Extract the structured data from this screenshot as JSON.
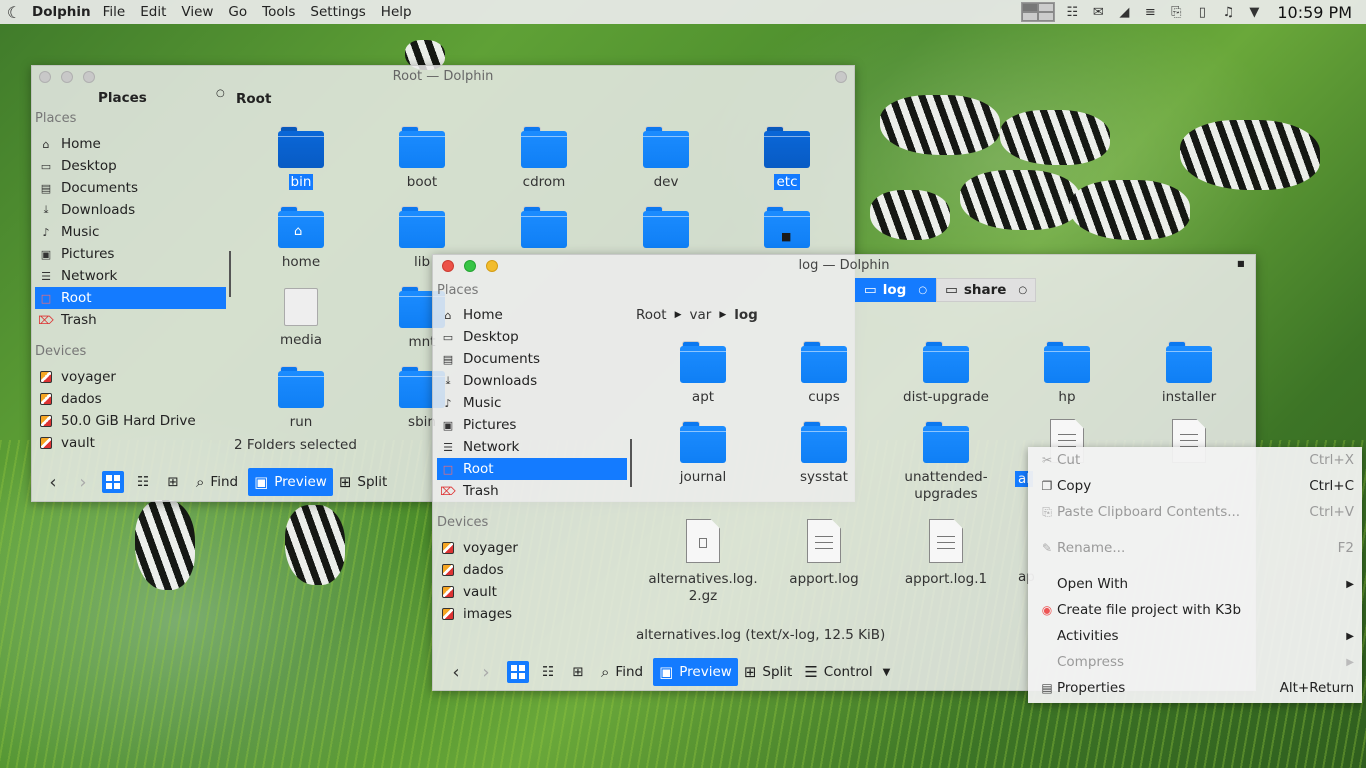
{
  "topbar": {
    "app_name": "Dolphin",
    "menus": [
      "File",
      "Edit",
      "View",
      "Go",
      "Tools",
      "Settings",
      "Help"
    ],
    "menu_underline": [
      "F",
      "E",
      "V",
      "G",
      "T",
      "S",
      "H"
    ],
    "clock": "10:59 PM"
  },
  "win1": {
    "title": "Root — Dolphin",
    "places_header": "Places",
    "location": "Root",
    "places_label": "Places",
    "places": [
      "Home",
      "Desktop",
      "Documents",
      "Downloads",
      "Music",
      "Pictures",
      "Network",
      "Root",
      "Trash"
    ],
    "devices_label": "Devices",
    "devices": [
      "voyager",
      "dados",
      "50.0 GiB Hard Drive",
      "vault"
    ],
    "folders": [
      "bin",
      "boot",
      "cdrom",
      "dev",
      "etc",
      "home",
      "lib",
      "",
      "",
      "",
      "media",
      "mnt",
      "run",
      "sbin"
    ],
    "status": "2 Folders selected",
    "toolbar": {
      "find": "Find",
      "preview": "Preview",
      "split": "Split"
    }
  },
  "win2": {
    "title": "log — Dolphin",
    "tabs": [
      {
        "label": "log"
      },
      {
        "label": "share"
      }
    ],
    "places_label": "Places",
    "places": [
      "Home",
      "Desktop",
      "Documents",
      "Downloads",
      "Music",
      "Pictures",
      "Network",
      "Root",
      "Trash"
    ],
    "devices_label": "Devices",
    "devices": [
      "voyager",
      "dados",
      "vault",
      "images"
    ],
    "breadcrumb": [
      "Root",
      "var",
      "log"
    ],
    "folders": [
      "apt",
      "cups",
      "dist-upgrade",
      "hp",
      "installer",
      "journal",
      "sysstat",
      "unattended-\nupgrades"
    ],
    "selected_partial": "al",
    "files": [
      "alternatives.log.\n2.gz",
      "apport.log",
      "apport.log.1",
      "ap"
    ],
    "status": "alternatives.log (text/x-log, 12.5 KiB)",
    "toolbar": {
      "find": "Find",
      "preview": "Preview",
      "split": "Split",
      "control": "Control"
    }
  },
  "context_menu": {
    "items": [
      {
        "label": "Cut",
        "shortcut": "Ctrl+X",
        "enabled": false,
        "icon": "scissors-icon"
      },
      {
        "label": "Copy",
        "shortcut": "Ctrl+C",
        "enabled": true,
        "icon": "copy-icon"
      },
      {
        "label": "Paste Clipboard Contents...",
        "shortcut": "Ctrl+V",
        "enabled": false,
        "icon": "paste-icon"
      },
      {
        "label": "Rename...",
        "shortcut": "F2",
        "enabled": false,
        "icon": "rename-icon"
      },
      {
        "label": "Open With",
        "shortcut": "",
        "enabled": true,
        "submenu": true
      },
      {
        "label": "Create file project with K3b",
        "shortcut": "",
        "enabled": true,
        "icon": "k3b-icon"
      },
      {
        "label": "Activities",
        "shortcut": "",
        "enabled": true,
        "submenu": true
      },
      {
        "label": "Compress",
        "shortcut": "",
        "enabled": false,
        "submenu": true
      },
      {
        "label": "Properties",
        "shortcut": "Alt+Return",
        "enabled": true,
        "icon": "properties-icon"
      }
    ]
  },
  "colors": {
    "accent": "#147bff",
    "folder": "#1c8cff"
  }
}
